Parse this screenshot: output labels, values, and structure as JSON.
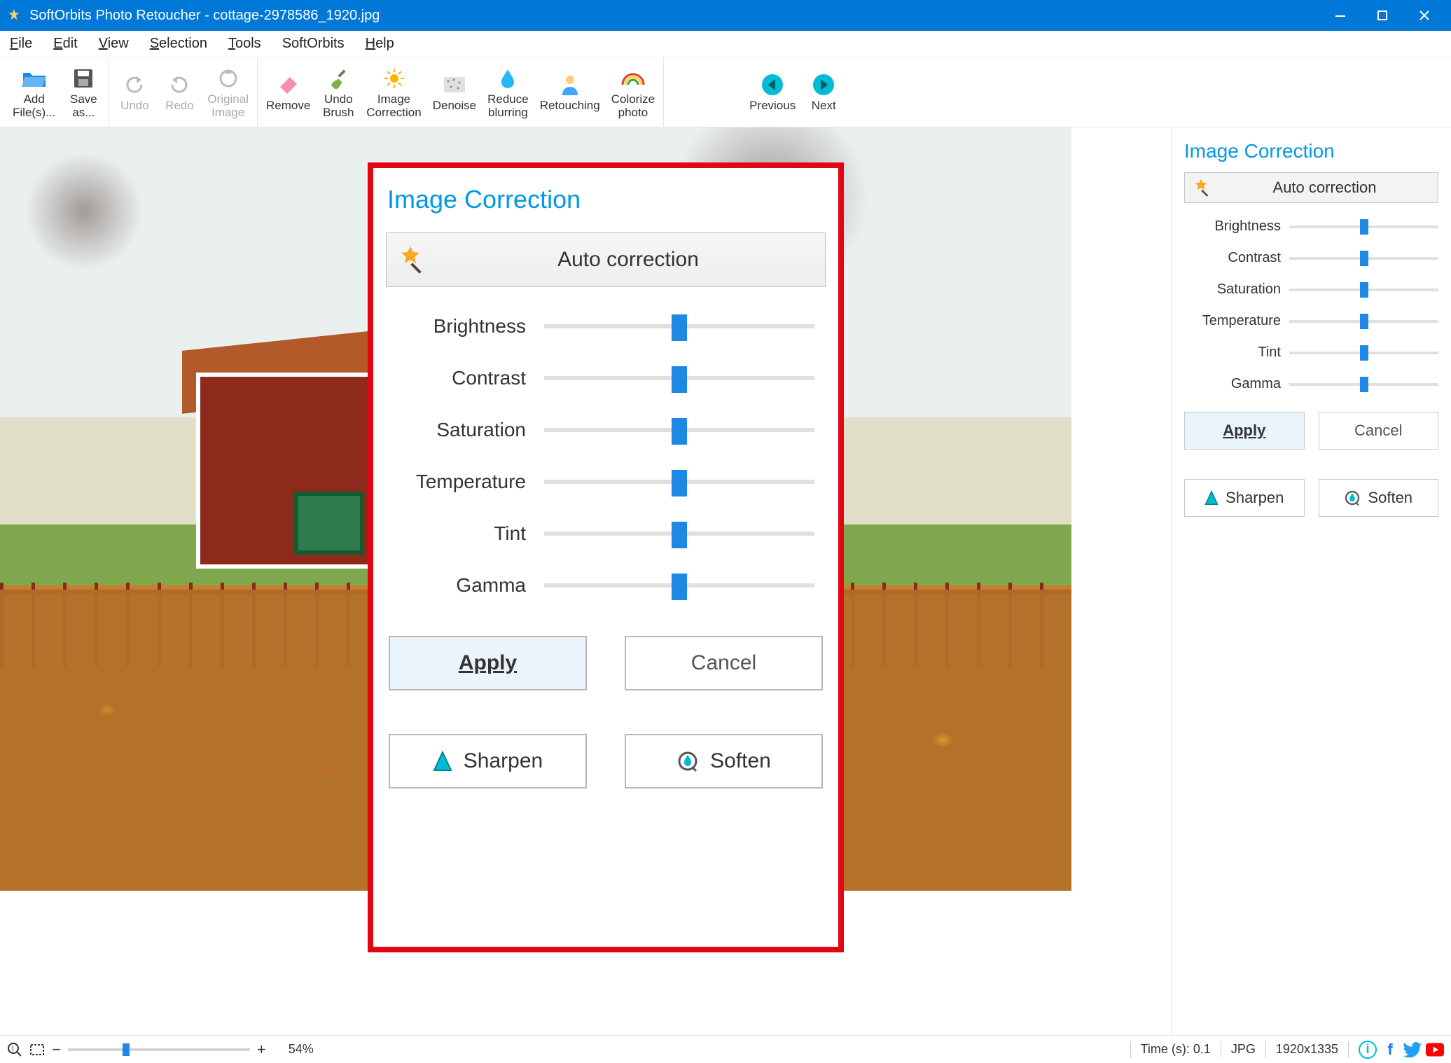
{
  "titlebar": {
    "app": "SoftOrbits Photo Retoucher",
    "file": "cottage-2978586_1920.jpg"
  },
  "menu": {
    "file": "File",
    "edit": "Edit",
    "view": "View",
    "selection": "Selection",
    "tools": "Tools",
    "softorbits": "SoftOrbits",
    "help": "Help"
  },
  "toolbar": {
    "addfiles": "Add\nFile(s)...",
    "saveas": "Save\nas...",
    "undo": "Undo",
    "redo": "Redo",
    "original": "Original\nImage",
    "remove": "Remove",
    "undobrush": "Undo\nBrush",
    "imgcorr": "Image\nCorrection",
    "denoise": "Denoise",
    "reduceblur": "Reduce\nblurring",
    "retouch": "Retouching",
    "colorize": "Colorize\nphoto",
    "prev": "Previous",
    "next": "Next"
  },
  "panel": {
    "title": "Image Correction",
    "auto": "Auto correction",
    "sliders": [
      "Brightness",
      "Contrast",
      "Saturation",
      "Temperature",
      "Tint",
      "Gamma"
    ],
    "apply": "Apply",
    "cancel": "Cancel",
    "sharpen": "Sharpen",
    "soften": "Soften"
  },
  "status": {
    "zoom": "54%",
    "time": "Time (s): 0.1",
    "fmt": "JPG",
    "dims": "1920x1335"
  }
}
